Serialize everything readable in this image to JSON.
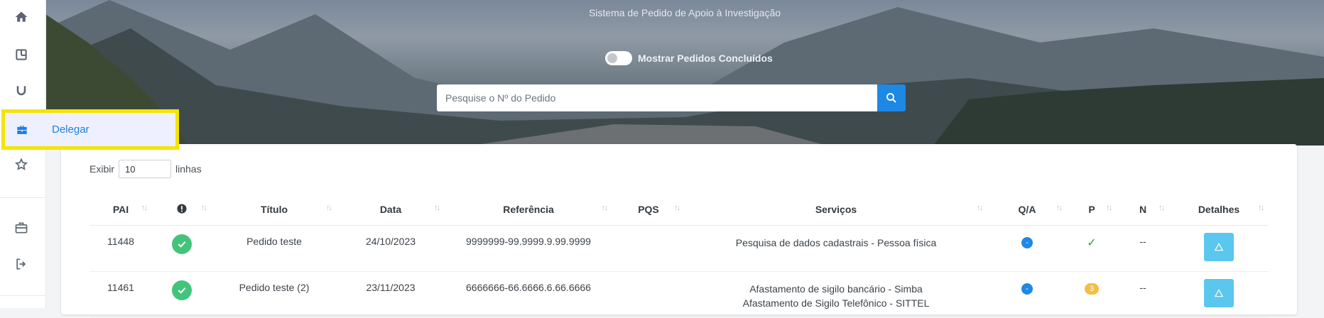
{
  "sidebar": {
    "icons": [
      "home-icon",
      "board-icon",
      "magnet-icon",
      "briefcase-icon",
      "star-icon",
      "briefcase-outline-icon",
      "logout-icon"
    ],
    "popup_label": "Delegar"
  },
  "header": {
    "subtitle": "Sistema de Pedido de Apoio à Investigação",
    "toggle_label": "Mostrar Pedidos Concluídos",
    "toggle_on": false
  },
  "search": {
    "placeholder": "Pesquise o Nº do Pedido"
  },
  "table_controls": {
    "show_label": "Exibir",
    "rows_value": "10",
    "rows_label": "linhas"
  },
  "table": {
    "columns": [
      "PAI",
      "",
      "Título",
      "Data",
      "Referência",
      "PQS",
      "Serviços",
      "Q/A",
      "P",
      "N",
      "Detalhes"
    ],
    "rows": [
      {
        "pai": "11448",
        "titulo": "Pedido teste",
        "data": "24/10/2023",
        "referencia": "9999999-99.9999.9.99.9999",
        "pqs": "",
        "servicos": [
          "Pesquisa de dados cadastrais - Pessoa física"
        ],
        "qa": "-",
        "p": "✓",
        "n": "--"
      },
      {
        "pai": "11461",
        "titulo": "Pedido teste (2)",
        "data": "23/11/2023",
        "referencia": "6666666-66.6666.6.66.6666",
        "pqs": "",
        "servicos": [
          "Afastamento de sigilo bancário - Simba",
          "Afastamento de Sigilo Telefônico - SITTEL"
        ],
        "qa": "-",
        "p": "3",
        "n": "--"
      }
    ]
  },
  "colors": {
    "accent": "#1e88e5",
    "success": "#42c47b",
    "warning": "#f6bd43",
    "info_button": "#5bc7ef",
    "highlight_border": "#f5e400"
  }
}
